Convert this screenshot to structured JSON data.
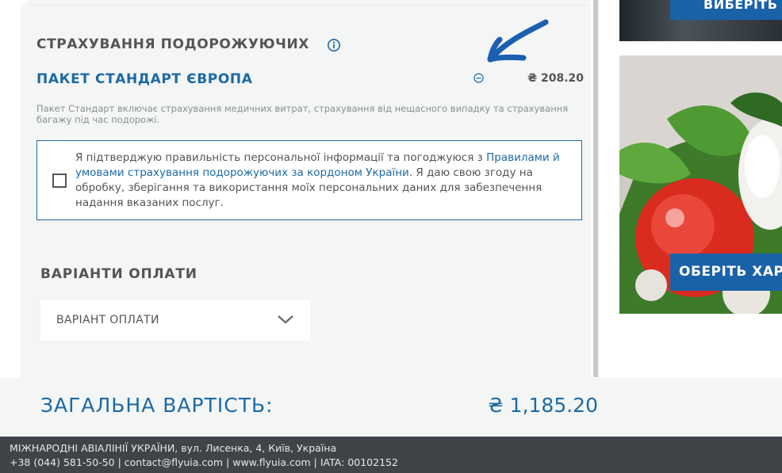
{
  "insurance": {
    "title": "СТРАХУВАННЯ ПОДОРОЖУЮЧИХ",
    "package_name": "ПАКЕТ СТАНДАРТ ЄВРОПА",
    "package_price": "₴ 208.20",
    "package_description": "Пакет Стандарт включає страхування медичних витрат, страхування від нещасного випадку та страхування багажу під час подорожі.",
    "consent": {
      "text_before": "Я підтверджую правильність персональної інформації та погоджуюся з ",
      "link_text": "Правилами й умовами страхування подорожуючих за кордоном України",
      "text_after": ". Я даю свою згоду на обробку, зберігання та використання моїх персональних даних для забезпечення надання вказаних послуг.",
      "checked": false
    }
  },
  "payment": {
    "title": "ВАРІАНТИ ОПЛАТИ",
    "select_value": "ВАРІАНТ ОПЛАТИ"
  },
  "ads": {
    "top_button": "ВИБЕРІТЬ",
    "bottom_button": "ОБЕРІТЬ ХАР"
  },
  "total": {
    "label": "ЗАГАЛЬНА ВАРТІСТЬ:",
    "value": "₴ 1,185.20"
  },
  "footer": {
    "line1": "МІЖНАРОДНІ АВІАЛІНІЇ УКРАЇНИ, вул. Лисенка, 4, Київ, Україна",
    "line2": "+38 (044) 581-50-50 | contact@flyuia.com | www.flyuia.com | IATA: 00102152"
  },
  "colors": {
    "brand_blue": "#1d6aa5",
    "panel_bg": "#f4f5f5",
    "footer_bg": "#404347",
    "annotation_arrow": "#1a5fb0"
  },
  "icons": [
    "info-icon",
    "remove-icon",
    "chevron-down-icon",
    "checkbox-icon",
    "annotation-arrow-icon"
  ]
}
